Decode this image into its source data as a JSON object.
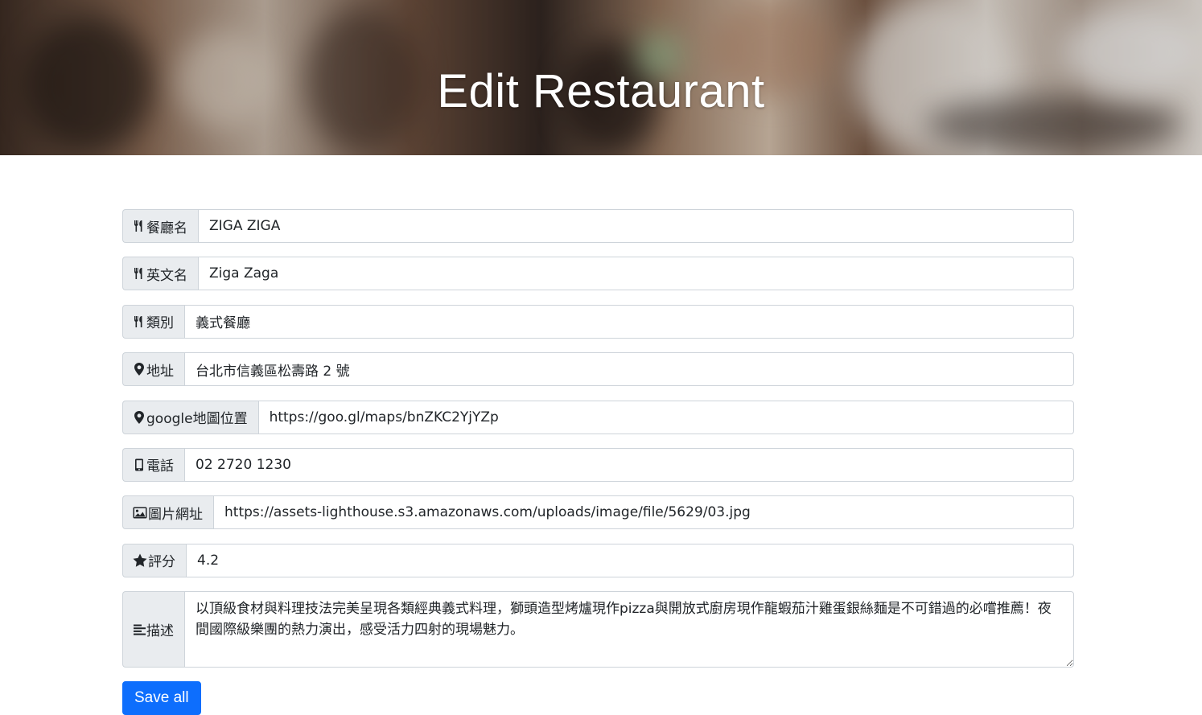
{
  "header": {
    "title": "Edit Restaurant"
  },
  "form": {
    "fields": [
      {
        "icon": "utensils-icon",
        "label": "餐廳名",
        "value": "ZIGA ZIGA"
      },
      {
        "icon": "utensils-icon",
        "label": "英文名",
        "value": "Ziga Zaga"
      },
      {
        "icon": "utensils-icon",
        "label": "類別",
        "value": "義式餐廳"
      },
      {
        "icon": "map-marker-icon",
        "label": "地址",
        "value": "台北市信義區松壽路 2 號"
      },
      {
        "icon": "map-marker-icon",
        "label": "google地圖位置",
        "value": "https://goo.gl/maps/bnZKC2YjYZp"
      },
      {
        "icon": "mobile-phone-icon",
        "label": "電話",
        "value": "02 2720 1230"
      },
      {
        "icon": "image-icon",
        "label": "圖片網址",
        "value": "https://assets-lighthouse.s3.amazonaws.com/uploads/image/file/5629/03.jpg"
      },
      {
        "icon": "star-icon",
        "label": "評分",
        "value": "4.2"
      }
    ],
    "description": {
      "icon": "align-left-icon",
      "label": "描述",
      "value": "以頂級食材與料理技法完美呈現各類經典義式料理，獅頭造型烤爐現作pizza與開放式廚房現作龍蝦茄汁雞蛋銀絲麵是不可錯過的必嚐推薦！夜間國際級樂團的熱力演出，感受活力四射的現場魅力。"
    },
    "save_label": "Save all"
  },
  "colors": {
    "primary": "#0d6efd",
    "addon_bg": "#e9ecef",
    "border": "#ced4da"
  }
}
